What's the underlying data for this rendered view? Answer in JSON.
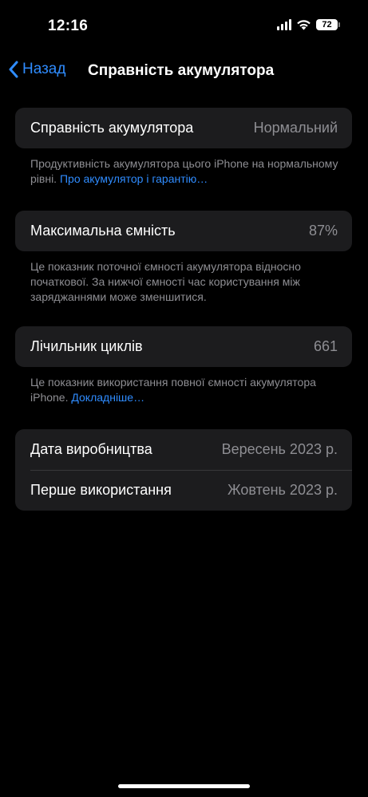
{
  "status_bar": {
    "time": "12:16",
    "battery_level": "72"
  },
  "nav": {
    "back_label": "Назад",
    "title": "Справність акумулятора"
  },
  "battery_health": {
    "label": "Справність акумулятора",
    "value": "Нормальний",
    "footnote_text": "Продуктивність акумулятора цього iPhone на нормальному рівні.",
    "footnote_link": "Про акумулятор і гарантію…"
  },
  "max_capacity": {
    "label": "Максимальна ємність",
    "value": "87%",
    "footnote_text": "Це показник поточної ємності акумулятора відносно початкової. За нижчої ємності час користування між заряджаннями може зменшитися."
  },
  "cycle_count": {
    "label": "Лічильник циклів",
    "value": "661",
    "footnote_text": "Це показник використання повної ємності акумулятора iPhone.",
    "footnote_link": "Докладніше…"
  },
  "dates": {
    "manufacture_label": "Дата виробництва",
    "manufacture_value": "Вересень 2023 р.",
    "first_use_label": "Перше використання",
    "first_use_value": "Жовтень 2023 р."
  },
  "colors": {
    "background": "#000000",
    "cell": "#1c1c1e",
    "accent": "#2f8cff",
    "secondary_text": "#8e8e93"
  }
}
